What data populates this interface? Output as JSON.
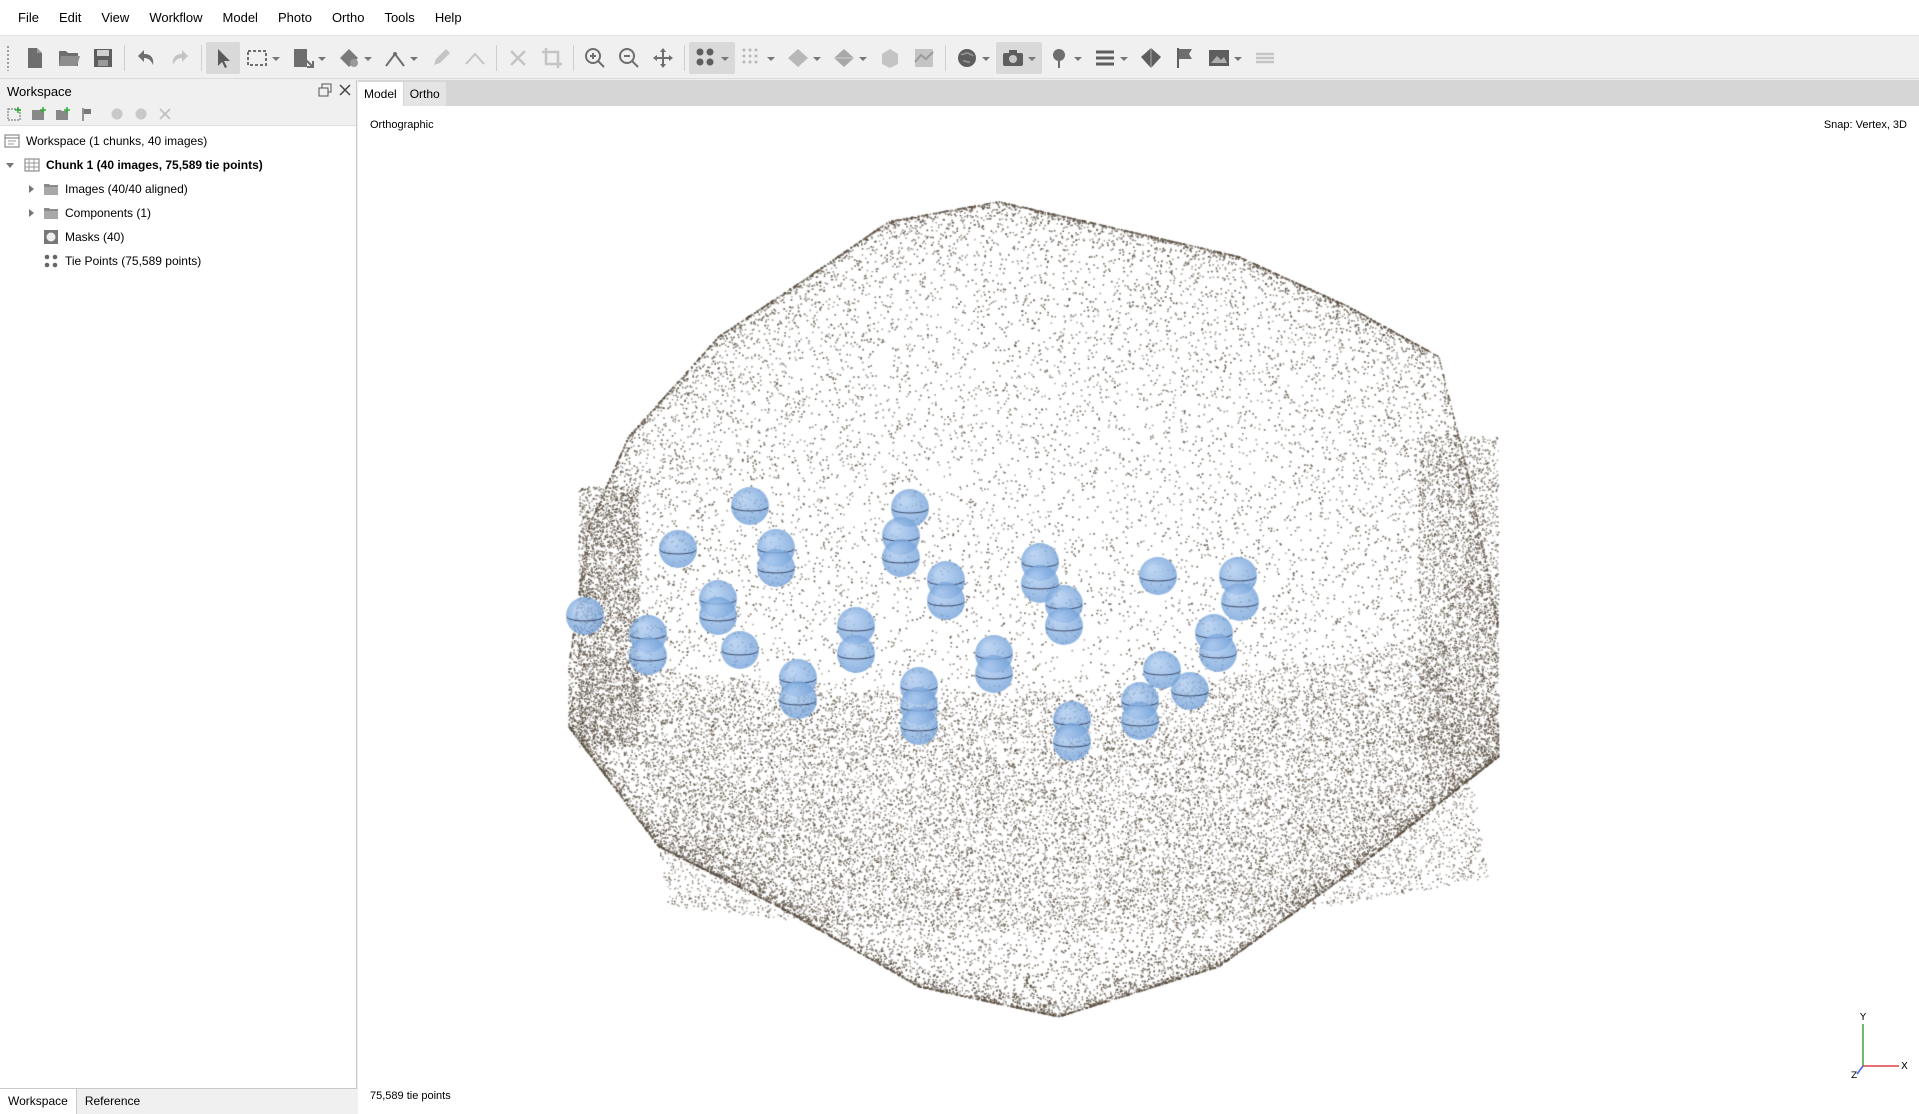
{
  "menu": [
    "File",
    "Edit",
    "View",
    "Workflow",
    "Model",
    "Photo",
    "Ortho",
    "Tools",
    "Help"
  ],
  "workspace_panel": {
    "title": "Workspace",
    "tree": {
      "root": "Workspace (1 chunks, 40 images)",
      "chunk": "Chunk 1 (40 images, 75,589 tie points)",
      "images": "Images (40/40 aligned)",
      "components": "Components (1)",
      "masks": "Masks (40)",
      "tie_points": "Tie Points (75,589 points)"
    },
    "bottom_tabs": [
      "Workspace",
      "Reference"
    ]
  },
  "view": {
    "tabs": [
      "Model",
      "Ortho"
    ],
    "projection": "Orthographic",
    "snap": "Snap: Vertex, 3D",
    "status": "75,589 tie points",
    "axis_labels": {
      "y": "Y",
      "x": "X",
      "z": "Z"
    }
  },
  "colors": {
    "point": "#5a4f42",
    "camera": "#6f9fd8",
    "axis_x": "#e04040",
    "axis_y": "#40a040",
    "axis_z": "#4060e0"
  }
}
